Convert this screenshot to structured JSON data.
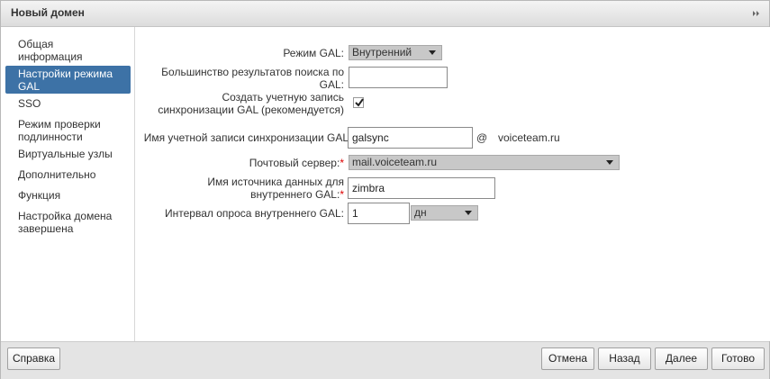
{
  "dialog": {
    "title": "Новый домен",
    "collapse_icon": "double-chevron-right-icon"
  },
  "sidebar": {
    "items": [
      {
        "label": "Общая информация"
      },
      {
        "label": "Настройки режима GAL",
        "active": true
      },
      {
        "label": "SSO"
      },
      {
        "label": "Режим проверки подлинности"
      },
      {
        "label": "Виртуальные узлы"
      },
      {
        "label": "Дополнительно"
      },
      {
        "label": "Функция"
      },
      {
        "label": "Настройка домена завершена"
      }
    ]
  },
  "form": {
    "gal_mode": {
      "label": "Режим GAL:",
      "value": "Внутренний"
    },
    "max_results": {
      "label_line1": "Большинство результатов поиска по",
      "label_line2": "GAL:",
      "value": ""
    },
    "create_sync_account": {
      "label_line1": "Создать учетную запись",
      "label_line2": "синхронизации GAL (рекомендуется)",
      "checked": true
    },
    "sync_account": {
      "label": "Имя учетной записи синхронизации GAL",
      "value": "galsync",
      "at": "@",
      "domain": "voiceteam.ru"
    },
    "mail_server": {
      "label": "Почтовый сервер:",
      "required": "*",
      "value": "mail.voiceteam.ru"
    },
    "datasource_name": {
      "label_line1": "Имя источника данных для",
      "label_line2": "внутреннего GAL:",
      "required": "*",
      "value": "zimbra"
    },
    "polling_interval": {
      "label": "Интервал опроса внутреннего GAL:",
      "value": "1",
      "unit": "дн"
    }
  },
  "footer": {
    "help": "Справка",
    "cancel": "Отмена",
    "back": "Назад",
    "next": "Далее",
    "finish": "Готово"
  }
}
